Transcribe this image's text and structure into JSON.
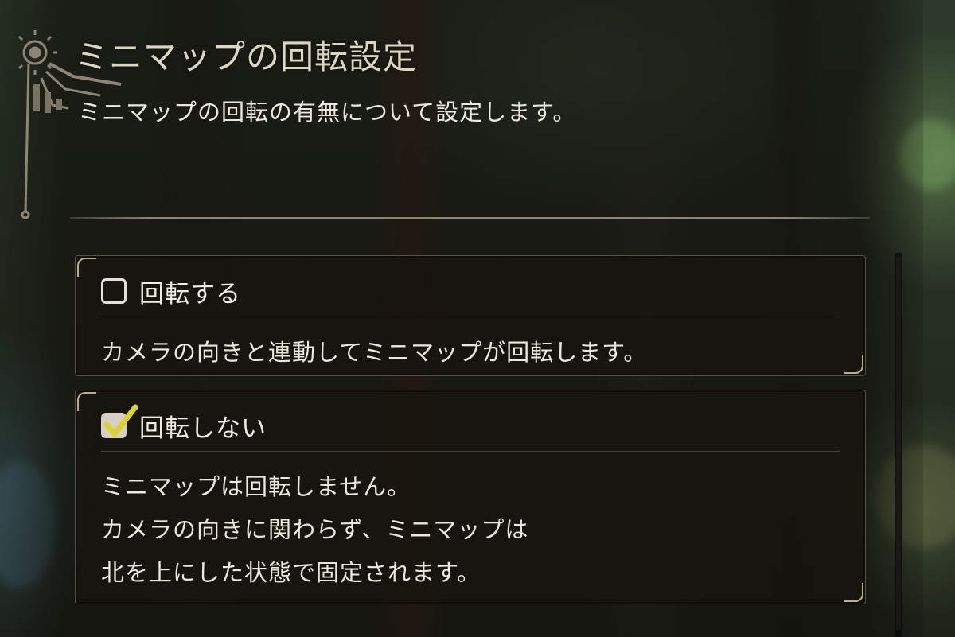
{
  "header": {
    "title": "ミニマップの回転設定",
    "description": "ミニマップの回転の有無について設定します。",
    "emblem_icon": "ornate-emblem-icon"
  },
  "options": [
    {
      "label": "回転する",
      "checked": false,
      "description_lines": [
        "カメラの向きと連動してミニマップが回転します。"
      ]
    },
    {
      "label": "回転しない",
      "checked": true,
      "description_lines": [
        "ミニマップは回転しません。",
        "カメラの向きに関わらず、ミニマップは",
        "北を上にした状態で固定されます。"
      ]
    }
  ],
  "colors": {
    "text": "#ece8dc",
    "title": "#dcd6bf",
    "card_border": "#b9af8f",
    "checkmark": "#d9d232"
  }
}
